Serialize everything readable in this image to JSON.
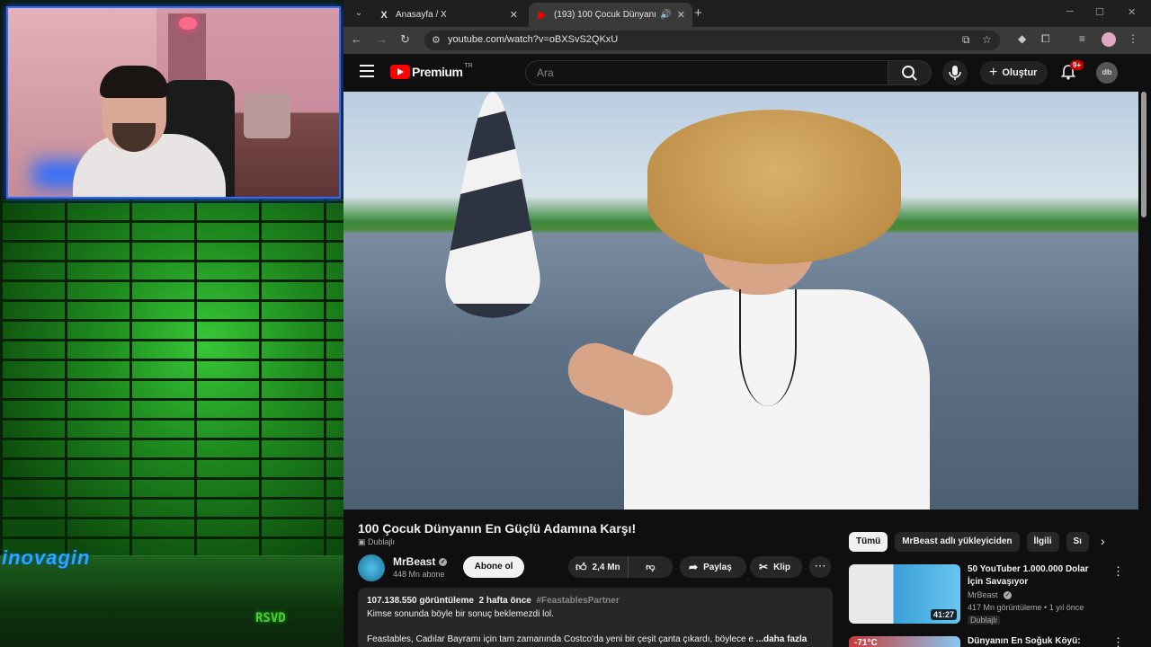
{
  "overlay": {
    "brand_text": "inovagin",
    "corner_badge": "RSVD"
  },
  "browser": {
    "tabs": [
      {
        "icon": "X",
        "title": "Anasayfa / X",
        "active": false
      },
      {
        "icon": "▶",
        "title": "(193) 100 Çocuk Dünyanın E",
        "active": true
      }
    ],
    "url": "youtube.com/watch?v=oBXSvS2QKxU"
  },
  "youtube": {
    "logo_text": "Premium",
    "logo_region": "TR",
    "search_placeholder": "Ara",
    "create_label": "Oluştur",
    "notifications_badge": "9+",
    "avatar_text": "dlb"
  },
  "video": {
    "title": "100 Çocuk Dünyanın En Güçlü Adamına Karşı!",
    "dub_label": "Dublajlı",
    "channel_name": "MrBeast",
    "channel_subs": "448 Mn abone",
    "subscribe_label": "Abone ol",
    "likes": "2,4 Mn",
    "share_label": "Paylaş",
    "clip_label": "Klip",
    "views": "107.138.550 görüntüleme",
    "age": "2 hafta önce",
    "hashtag": "#FeastablesPartner",
    "desc_line1": "Kimse sonunda böyle bir sonuç beklemezdi lol.",
    "desc_line2": "Feastables, Cadılar Bayramı için tam zamanında Costco'da yeni bir çeşit çanta çıkardı, böylece e",
    "desc_more": "...daha fazla"
  },
  "sidebar": {
    "chips": [
      "Tümü",
      "MrBeast adlı yükleyiciden",
      "İlgili",
      "Sı"
    ],
    "recommendations": [
      {
        "title": "50 YouTuber 1.000.000 Dolar İçin Savaşıyor",
        "channel": "MrBeast",
        "meta": "417 Mn görüntüleme • 1 yıl önce",
        "badge": "Dublajlı",
        "duration": "41:27"
      },
      {
        "title": "Dünyanın En Soğuk Köyü:",
        "thumb_text": "-71°C"
      }
    ]
  }
}
